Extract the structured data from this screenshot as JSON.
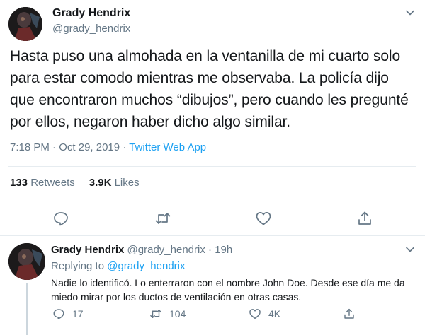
{
  "main_tweet": {
    "author_name": "Grady Hendrix",
    "author_handle": "@grady_hendrix",
    "text": "Hasta puso una almohada en la ventanilla de mi cuarto solo para estar comodo mientras me observaba. La policía dijo que encontraron muchos “dibujos”, pero cuando les pregunté por ellos, negaron haber dicho algo similar.",
    "time": "7:18 PM",
    "date": "Oct 29, 2019",
    "separator": "·",
    "source_app": "Twitter Web App",
    "retweets_count": "133",
    "retweets_label": "Retweets",
    "likes_count": "3.9K",
    "likes_label": "Likes",
    "actions": [
      "reply-icon",
      "retweet-icon",
      "like-icon",
      "share-icon"
    ]
  },
  "reply_tweet": {
    "author_name": "Grady Hendrix",
    "author_handle": "@grady_hendrix",
    "separator": "·",
    "time_ago": "19h",
    "replying_label": "Replying to",
    "replying_to": "@grady_hendrix",
    "text": "Nadie lo identificó. Lo enterraron con el nombre John Doe. Desde ese día me da miedo mirar por los ductos de ventilación en otras casas.",
    "reply_count": "17",
    "retweet_count": "104",
    "like_count": "4K"
  },
  "colors": {
    "text": "#14171a",
    "secondary": "#657786",
    "accent": "#1da1f2",
    "divider": "#e6ecf0"
  }
}
